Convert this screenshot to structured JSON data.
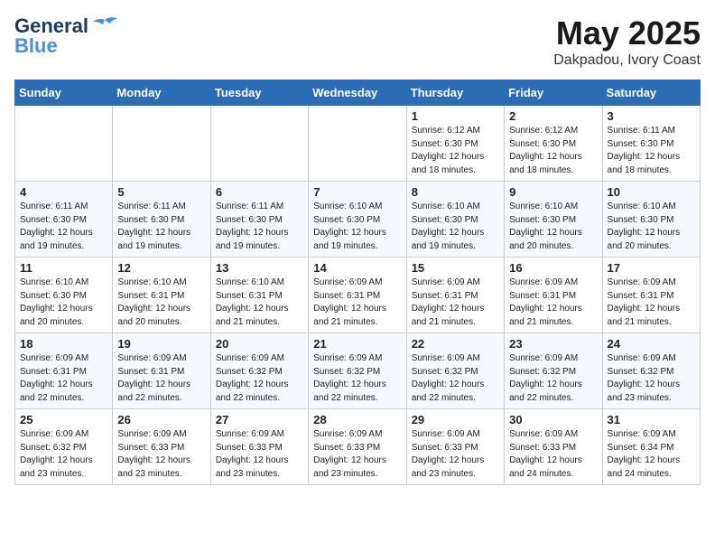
{
  "header": {
    "logo_line1": "General",
    "logo_line2": "Blue",
    "month_year": "May 2025",
    "location": "Dakpadou, Ivory Coast"
  },
  "weekdays": [
    "Sunday",
    "Monday",
    "Tuesday",
    "Wednesday",
    "Thursday",
    "Friday",
    "Saturday"
  ],
  "weeks": [
    [
      {
        "day": "",
        "info": ""
      },
      {
        "day": "",
        "info": ""
      },
      {
        "day": "",
        "info": ""
      },
      {
        "day": "",
        "info": ""
      },
      {
        "day": "1",
        "info": "Sunrise: 6:12 AM\nSunset: 6:30 PM\nDaylight: 12 hours\nand 18 minutes."
      },
      {
        "day": "2",
        "info": "Sunrise: 6:12 AM\nSunset: 6:30 PM\nDaylight: 12 hours\nand 18 minutes."
      },
      {
        "day": "3",
        "info": "Sunrise: 6:11 AM\nSunset: 6:30 PM\nDaylight: 12 hours\nand 18 minutes."
      }
    ],
    [
      {
        "day": "4",
        "info": "Sunrise: 6:11 AM\nSunset: 6:30 PM\nDaylight: 12 hours\nand 19 minutes."
      },
      {
        "day": "5",
        "info": "Sunrise: 6:11 AM\nSunset: 6:30 PM\nDaylight: 12 hours\nand 19 minutes."
      },
      {
        "day": "6",
        "info": "Sunrise: 6:11 AM\nSunset: 6:30 PM\nDaylight: 12 hours\nand 19 minutes."
      },
      {
        "day": "7",
        "info": "Sunrise: 6:10 AM\nSunset: 6:30 PM\nDaylight: 12 hours\nand 19 minutes."
      },
      {
        "day": "8",
        "info": "Sunrise: 6:10 AM\nSunset: 6:30 PM\nDaylight: 12 hours\nand 19 minutes."
      },
      {
        "day": "9",
        "info": "Sunrise: 6:10 AM\nSunset: 6:30 PM\nDaylight: 12 hours\nand 20 minutes."
      },
      {
        "day": "10",
        "info": "Sunrise: 6:10 AM\nSunset: 6:30 PM\nDaylight: 12 hours\nand 20 minutes."
      }
    ],
    [
      {
        "day": "11",
        "info": "Sunrise: 6:10 AM\nSunset: 6:30 PM\nDaylight: 12 hours\nand 20 minutes."
      },
      {
        "day": "12",
        "info": "Sunrise: 6:10 AM\nSunset: 6:31 PM\nDaylight: 12 hours\nand 20 minutes."
      },
      {
        "day": "13",
        "info": "Sunrise: 6:10 AM\nSunset: 6:31 PM\nDaylight: 12 hours\nand 21 minutes."
      },
      {
        "day": "14",
        "info": "Sunrise: 6:09 AM\nSunset: 6:31 PM\nDaylight: 12 hours\nand 21 minutes."
      },
      {
        "day": "15",
        "info": "Sunrise: 6:09 AM\nSunset: 6:31 PM\nDaylight: 12 hours\nand 21 minutes."
      },
      {
        "day": "16",
        "info": "Sunrise: 6:09 AM\nSunset: 6:31 PM\nDaylight: 12 hours\nand 21 minutes."
      },
      {
        "day": "17",
        "info": "Sunrise: 6:09 AM\nSunset: 6:31 PM\nDaylight: 12 hours\nand 21 minutes."
      }
    ],
    [
      {
        "day": "18",
        "info": "Sunrise: 6:09 AM\nSunset: 6:31 PM\nDaylight: 12 hours\nand 22 minutes."
      },
      {
        "day": "19",
        "info": "Sunrise: 6:09 AM\nSunset: 6:31 PM\nDaylight: 12 hours\nand 22 minutes."
      },
      {
        "day": "20",
        "info": "Sunrise: 6:09 AM\nSunset: 6:32 PM\nDaylight: 12 hours\nand 22 minutes."
      },
      {
        "day": "21",
        "info": "Sunrise: 6:09 AM\nSunset: 6:32 PM\nDaylight: 12 hours\nand 22 minutes."
      },
      {
        "day": "22",
        "info": "Sunrise: 6:09 AM\nSunset: 6:32 PM\nDaylight: 12 hours\nand 22 minutes."
      },
      {
        "day": "23",
        "info": "Sunrise: 6:09 AM\nSunset: 6:32 PM\nDaylight: 12 hours\nand 22 minutes."
      },
      {
        "day": "24",
        "info": "Sunrise: 6:09 AM\nSunset: 6:32 PM\nDaylight: 12 hours\nand 23 minutes."
      }
    ],
    [
      {
        "day": "25",
        "info": "Sunrise: 6:09 AM\nSunset: 6:32 PM\nDaylight: 12 hours\nand 23 minutes."
      },
      {
        "day": "26",
        "info": "Sunrise: 6:09 AM\nSunset: 6:33 PM\nDaylight: 12 hours\nand 23 minutes."
      },
      {
        "day": "27",
        "info": "Sunrise: 6:09 AM\nSunset: 6:33 PM\nDaylight: 12 hours\nand 23 minutes."
      },
      {
        "day": "28",
        "info": "Sunrise: 6:09 AM\nSunset: 6:33 PM\nDaylight: 12 hours\nand 23 minutes."
      },
      {
        "day": "29",
        "info": "Sunrise: 6:09 AM\nSunset: 6:33 PM\nDaylight: 12 hours\nand 23 minutes."
      },
      {
        "day": "30",
        "info": "Sunrise: 6:09 AM\nSunset: 6:33 PM\nDaylight: 12 hours\nand 24 minutes."
      },
      {
        "day": "31",
        "info": "Sunrise: 6:09 AM\nSunset: 6:34 PM\nDaylight: 12 hours\nand 24 minutes."
      }
    ]
  ]
}
